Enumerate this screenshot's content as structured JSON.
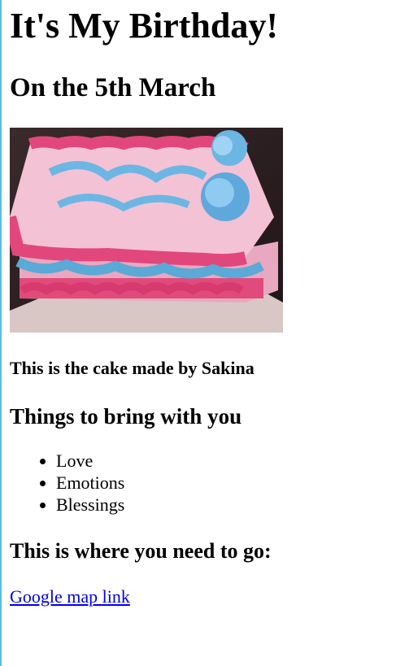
{
  "page": {
    "title": "It's My Birthday!",
    "subtitle": "On the 5th March",
    "image": {
      "alt": "cake",
      "icon": "birthday-cake-photo"
    },
    "caption": "This is the cake made by Sakina",
    "bring_heading": "Things to bring with you",
    "bring_items": [
      "Love",
      "Emotions",
      "Blessings"
    ],
    "location_heading": "This is where you need to go:",
    "map_link_text": "Google map link"
  },
  "colors": {
    "link": "#0000ee",
    "left_rule": "#5bc0de"
  }
}
